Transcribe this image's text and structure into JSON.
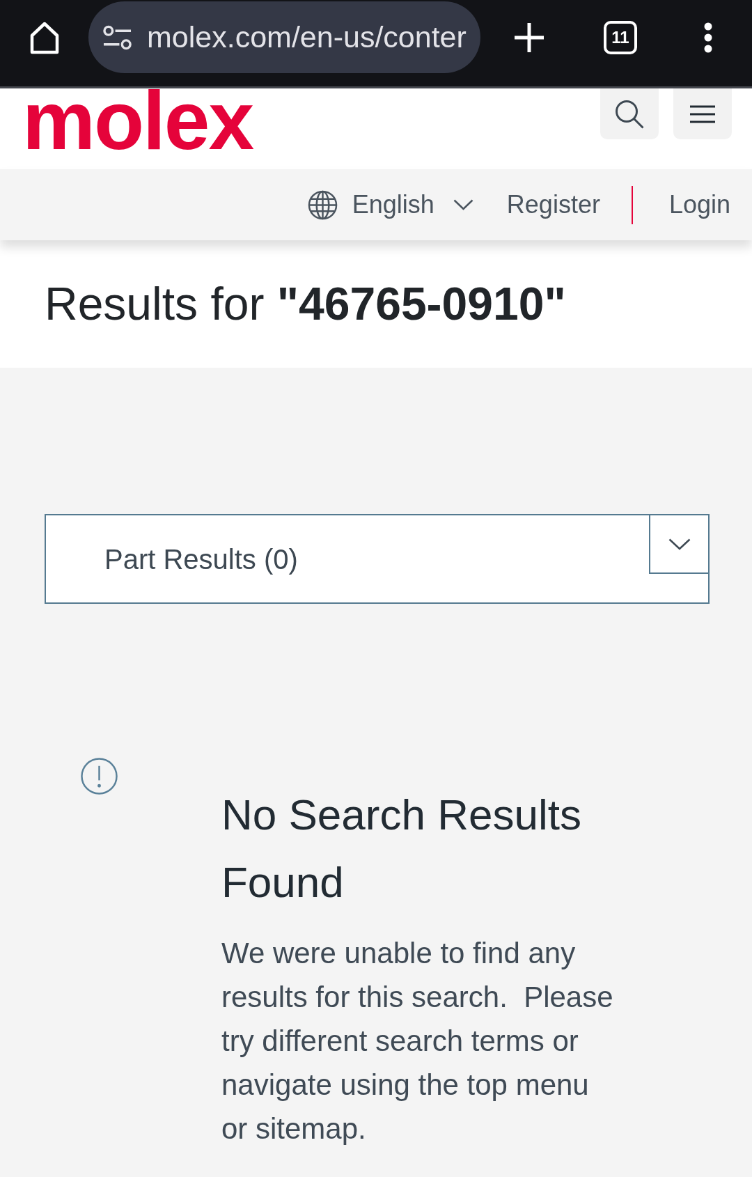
{
  "browser": {
    "url": "molex.com/en-us/conter",
    "tab_count": "11"
  },
  "header": {
    "logo": "molex"
  },
  "utility_nav": {
    "language": "English",
    "links": [
      "Register",
      "Login"
    ]
  },
  "page_title": "Results for **\"46765-0910\"**",
  "results_panel": {
    "label": "Part Results (0)",
    "expanded": false
  },
  "message": {
    "heading": "No Search Results Found",
    "body": "We were unable to find any results for this search.  Please try different search terms or navigate using the top menu or sitemap."
  }
}
